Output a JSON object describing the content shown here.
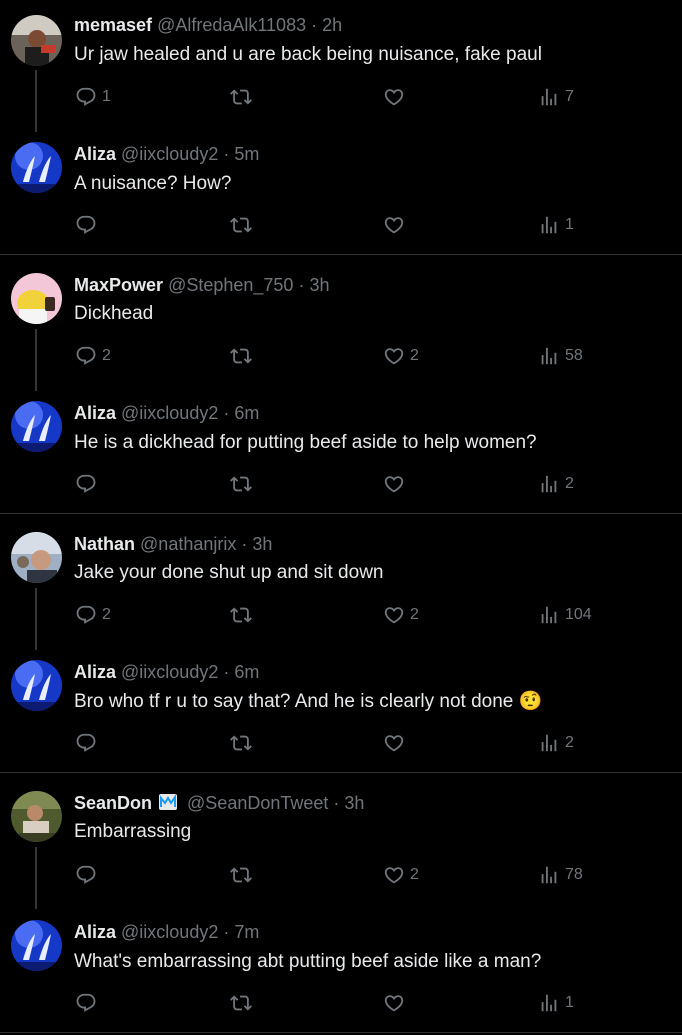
{
  "thread": [
    {
      "name": "memasef",
      "handle": "@AlfredaAlk11083",
      "time": "2h",
      "text": "Ur jaw healed and u are back being nuisance, fake paul",
      "replies": "1",
      "retweets": "",
      "likes": "",
      "views": "7"
    },
    {
      "name": "Aliza",
      "handle": "@iixcloudy2",
      "time": "5m",
      "text": "A nuisance? How?",
      "replies": "",
      "retweets": "",
      "likes": "",
      "views": "1"
    },
    {
      "name": "MaxPower",
      "handle": "@Stephen_750",
      "time": "3h",
      "text": "Dickhead",
      "replies": "2",
      "retweets": "",
      "likes": "2",
      "views": "58"
    },
    {
      "name": "Aliza",
      "handle": "@iixcloudy2",
      "time": "6m",
      "text": "He is a dickhead for putting beef aside to help women?",
      "replies": "",
      "retweets": "",
      "likes": "",
      "views": "2"
    },
    {
      "name": "Nathan",
      "handle": "@nathanjrix",
      "time": "3h",
      "text": "Jake your done shut up and sit down",
      "replies": "2",
      "retweets": "",
      "likes": "2",
      "views": "104"
    },
    {
      "name": "Aliza",
      "handle": "@iixcloudy2",
      "time": "6m",
      "text": "Bro who tf r u to say that? And he is clearly not done 🤨",
      "replies": "",
      "retweets": "",
      "likes": "",
      "views": "2"
    },
    {
      "name": "SeanDon",
      "handle": "@SeanDonTweet",
      "time": "3h",
      "text": "Embarrassing",
      "replies": "",
      "retweets": "",
      "likes": "2",
      "views": "78",
      "verified_badge": "verified-badge-icon"
    },
    {
      "name": "Aliza",
      "handle": "@iixcloudy2",
      "time": "7m",
      "text": "What's embarrassing abt putting beef aside like a man?",
      "replies": "",
      "retweets": "",
      "likes": "",
      "views": "1"
    }
  ],
  "separator": "·",
  "colors": {
    "background": "#000000",
    "text": "#e7e9ea",
    "muted": "#71767b",
    "divider": "#2f3336"
  }
}
